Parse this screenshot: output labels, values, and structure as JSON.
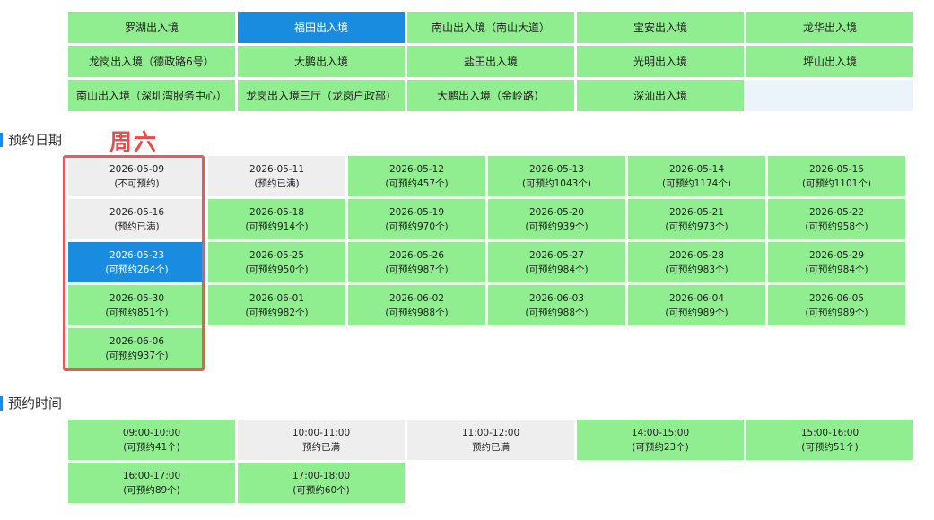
{
  "offices": [
    {
      "label": "罗湖出入境",
      "state": "available"
    },
    {
      "label": "福田出入境",
      "state": "selected"
    },
    {
      "label": "南山出入境（南山大道）",
      "state": "available"
    },
    {
      "label": "宝安出入境",
      "state": "available"
    },
    {
      "label": "龙华出入境",
      "state": "available"
    },
    {
      "label": "龙岗出入境（德政路6号）",
      "state": "available"
    },
    {
      "label": "大鹏出入境",
      "state": "available"
    },
    {
      "label": "盐田出入境",
      "state": "available"
    },
    {
      "label": "光明出入境",
      "state": "available"
    },
    {
      "label": "坪山出入境",
      "state": "available"
    },
    {
      "label": "南山出入境（深圳湾服务中心）",
      "state": "available"
    },
    {
      "label": "龙岗出入境三厅（龙岗户政部）",
      "state": "available"
    },
    {
      "label": "大鹏出入境（金岭路）",
      "state": "available"
    },
    {
      "label": "深汕出入境",
      "state": "available"
    },
    {
      "label": "",
      "state": "blank"
    }
  ],
  "labels": {
    "date_section": "预约日期",
    "time_section": "预约时间",
    "weekday_note": "周六"
  },
  "dates": [
    {
      "date": "2026-05-09",
      "status": "(不可预约)",
      "state": "full"
    },
    {
      "date": "2026-05-11",
      "status": "(预约已满)",
      "state": "full"
    },
    {
      "date": "2026-05-12",
      "status": "(可预约457个)",
      "state": "available"
    },
    {
      "date": "2026-05-13",
      "status": "(可预约1043个)",
      "state": "available"
    },
    {
      "date": "2026-05-14",
      "status": "(可预约1174个)",
      "state": "available"
    },
    {
      "date": "2026-05-15",
      "status": "(可预约1101个)",
      "state": "available"
    },
    {
      "date": "2026-05-16",
      "status": "(预约已满)",
      "state": "full"
    },
    {
      "date": "2026-05-18",
      "status": "(可预约914个)",
      "state": "available"
    },
    {
      "date": "2026-05-19",
      "status": "(可预约970个)",
      "state": "available"
    },
    {
      "date": "2026-05-20",
      "status": "(可预约939个)",
      "state": "available"
    },
    {
      "date": "2026-05-21",
      "status": "(可预约973个)",
      "state": "available"
    },
    {
      "date": "2026-05-22",
      "status": "(可预约958个)",
      "state": "available"
    },
    {
      "date": "2026-05-23",
      "status": "(可预约264个)",
      "state": "selected"
    },
    {
      "date": "2026-05-25",
      "status": "(可预约950个)",
      "state": "available"
    },
    {
      "date": "2026-05-26",
      "status": "(可预约987个)",
      "state": "available"
    },
    {
      "date": "2026-05-27",
      "status": "(可预约984个)",
      "state": "available"
    },
    {
      "date": "2026-05-28",
      "status": "(可预约983个)",
      "state": "available"
    },
    {
      "date": "2026-05-29",
      "status": "(可预约984个)",
      "state": "available"
    },
    {
      "date": "2026-05-30",
      "status": "(可预约851个)",
      "state": "available"
    },
    {
      "date": "2026-06-01",
      "status": "(可预约982个)",
      "state": "available"
    },
    {
      "date": "2026-06-02",
      "status": "(可预约988个)",
      "state": "available"
    },
    {
      "date": "2026-06-03",
      "status": "(可预约988个)",
      "state": "available"
    },
    {
      "date": "2026-06-04",
      "status": "(可预约989个)",
      "state": "available"
    },
    {
      "date": "2026-06-05",
      "status": "(可预约989个)",
      "state": "available"
    },
    {
      "date": "2026-06-06",
      "status": "(可预约937个)",
      "state": "available"
    }
  ],
  "times": [
    {
      "time": "09:00-10:00",
      "status": "(可预约41个)",
      "state": "available"
    },
    {
      "time": "10:00-11:00",
      "status": "预约已满",
      "state": "full"
    },
    {
      "time": "11:00-12:00",
      "status": "预约已满",
      "state": "full"
    },
    {
      "time": "14:00-15:00",
      "status": "(可预约23个)",
      "state": "available"
    },
    {
      "time": "15:00-16:00",
      "status": "(可预约51个)",
      "state": "available"
    },
    {
      "time": "16:00-17:00",
      "status": "(可预约89个)",
      "state": "available"
    },
    {
      "time": "17:00-18:00",
      "status": "(可预约60个)",
      "state": "available"
    }
  ],
  "colors": {
    "available": "#90ee90",
    "selected": "#1a8ce0",
    "full": "#eeeeee",
    "highlight_border": "#e85a5a"
  }
}
